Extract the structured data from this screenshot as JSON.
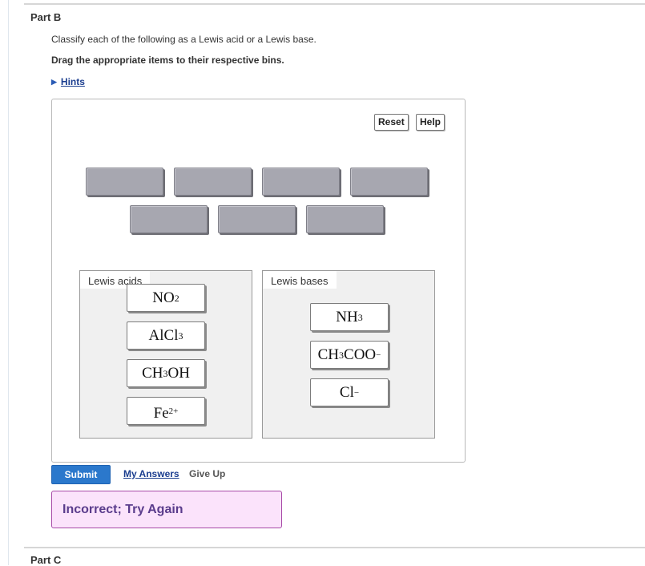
{
  "part_b": {
    "title": "Part B",
    "instruction": "Classify each of the following as a Lewis acid or a Lewis base.",
    "drag_instruction": "Drag the appropriate items to their respective bins.",
    "hints_label": "Hints"
  },
  "toolbar": {
    "reset_label": "Reset",
    "help_label": "Help"
  },
  "bins": {
    "acids": {
      "label": "Lewis acids",
      "items": [
        {
          "base": "NO",
          "sub": "2"
        },
        {
          "base": "AlCl",
          "sub": "3"
        },
        {
          "base": "CH",
          "sub": "3",
          "tail": "OH"
        },
        {
          "base": "Fe",
          "sup": "2+"
        }
      ]
    },
    "bases": {
      "label": "Lewis bases",
      "items": [
        {
          "base": "NH",
          "sub": "3"
        },
        {
          "base": "CH",
          "sub": "3",
          "tail": "COO",
          "sup": "−"
        },
        {
          "base": "Cl",
          "sup": "−"
        }
      ]
    }
  },
  "actions": {
    "submit_label": "Submit",
    "my_answers_label": "My Answers",
    "give_up_label": "Give Up"
  },
  "feedback": {
    "message": "Incorrect; Try Again"
  },
  "part_c": {
    "title": "Part C"
  },
  "colors": {
    "submit": "#2b78cc",
    "feedback_bg": "#fbe3fb",
    "feedback_border": "#a74aa7",
    "link": "#1a3d8f"
  }
}
